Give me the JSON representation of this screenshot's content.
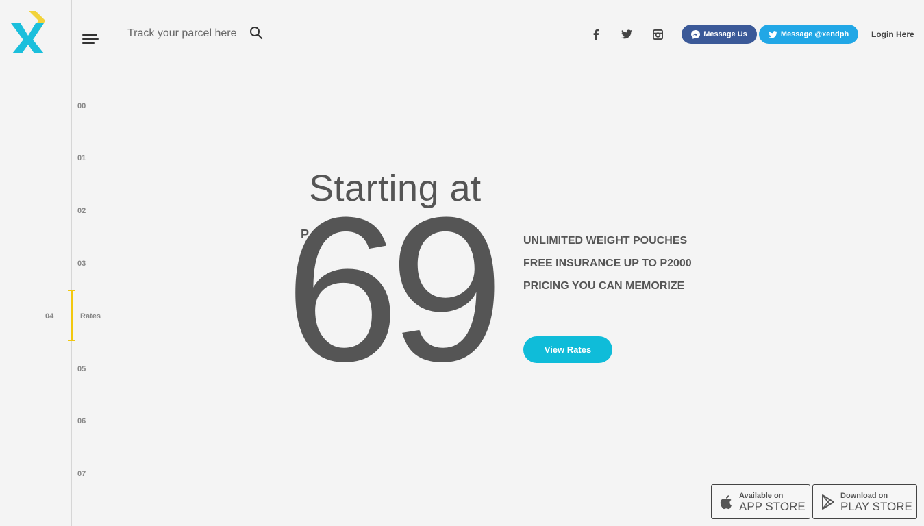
{
  "header": {
    "search_placeholder": "Track your parcel here",
    "message_us_label": "Message Us",
    "message_twitter_label": "Message @xendph",
    "login_label": "Login Here",
    "social_icons": [
      "facebook-icon",
      "twitter-icon",
      "instagram-icon"
    ]
  },
  "sidenav": {
    "items": [
      "00",
      "01",
      "02",
      "03",
      "04",
      "05",
      "06",
      "07"
    ],
    "active_number": "04",
    "active_label": "Rates"
  },
  "hero": {
    "heading": "Starting at",
    "currency": "P",
    "price": "69",
    "features": [
      "UNLIMITED WEIGHT POUCHES",
      "FREE INSURANCE UP TO P2000",
      "PRICING YOU CAN MEMORIZE"
    ],
    "cta_label": "View Rates"
  },
  "stores": {
    "app": {
      "small": "Available on",
      "big": "APP STORE"
    },
    "play": {
      "small": "Download on",
      "big": "PLAY STORE"
    }
  },
  "colors": {
    "accent_cyan": "#0fbcd9",
    "accent_yellow": "#f2c80f",
    "messenger_blue": "#3b5998",
    "twitter_blue": "#21a7e6",
    "text_dark": "#555555"
  }
}
